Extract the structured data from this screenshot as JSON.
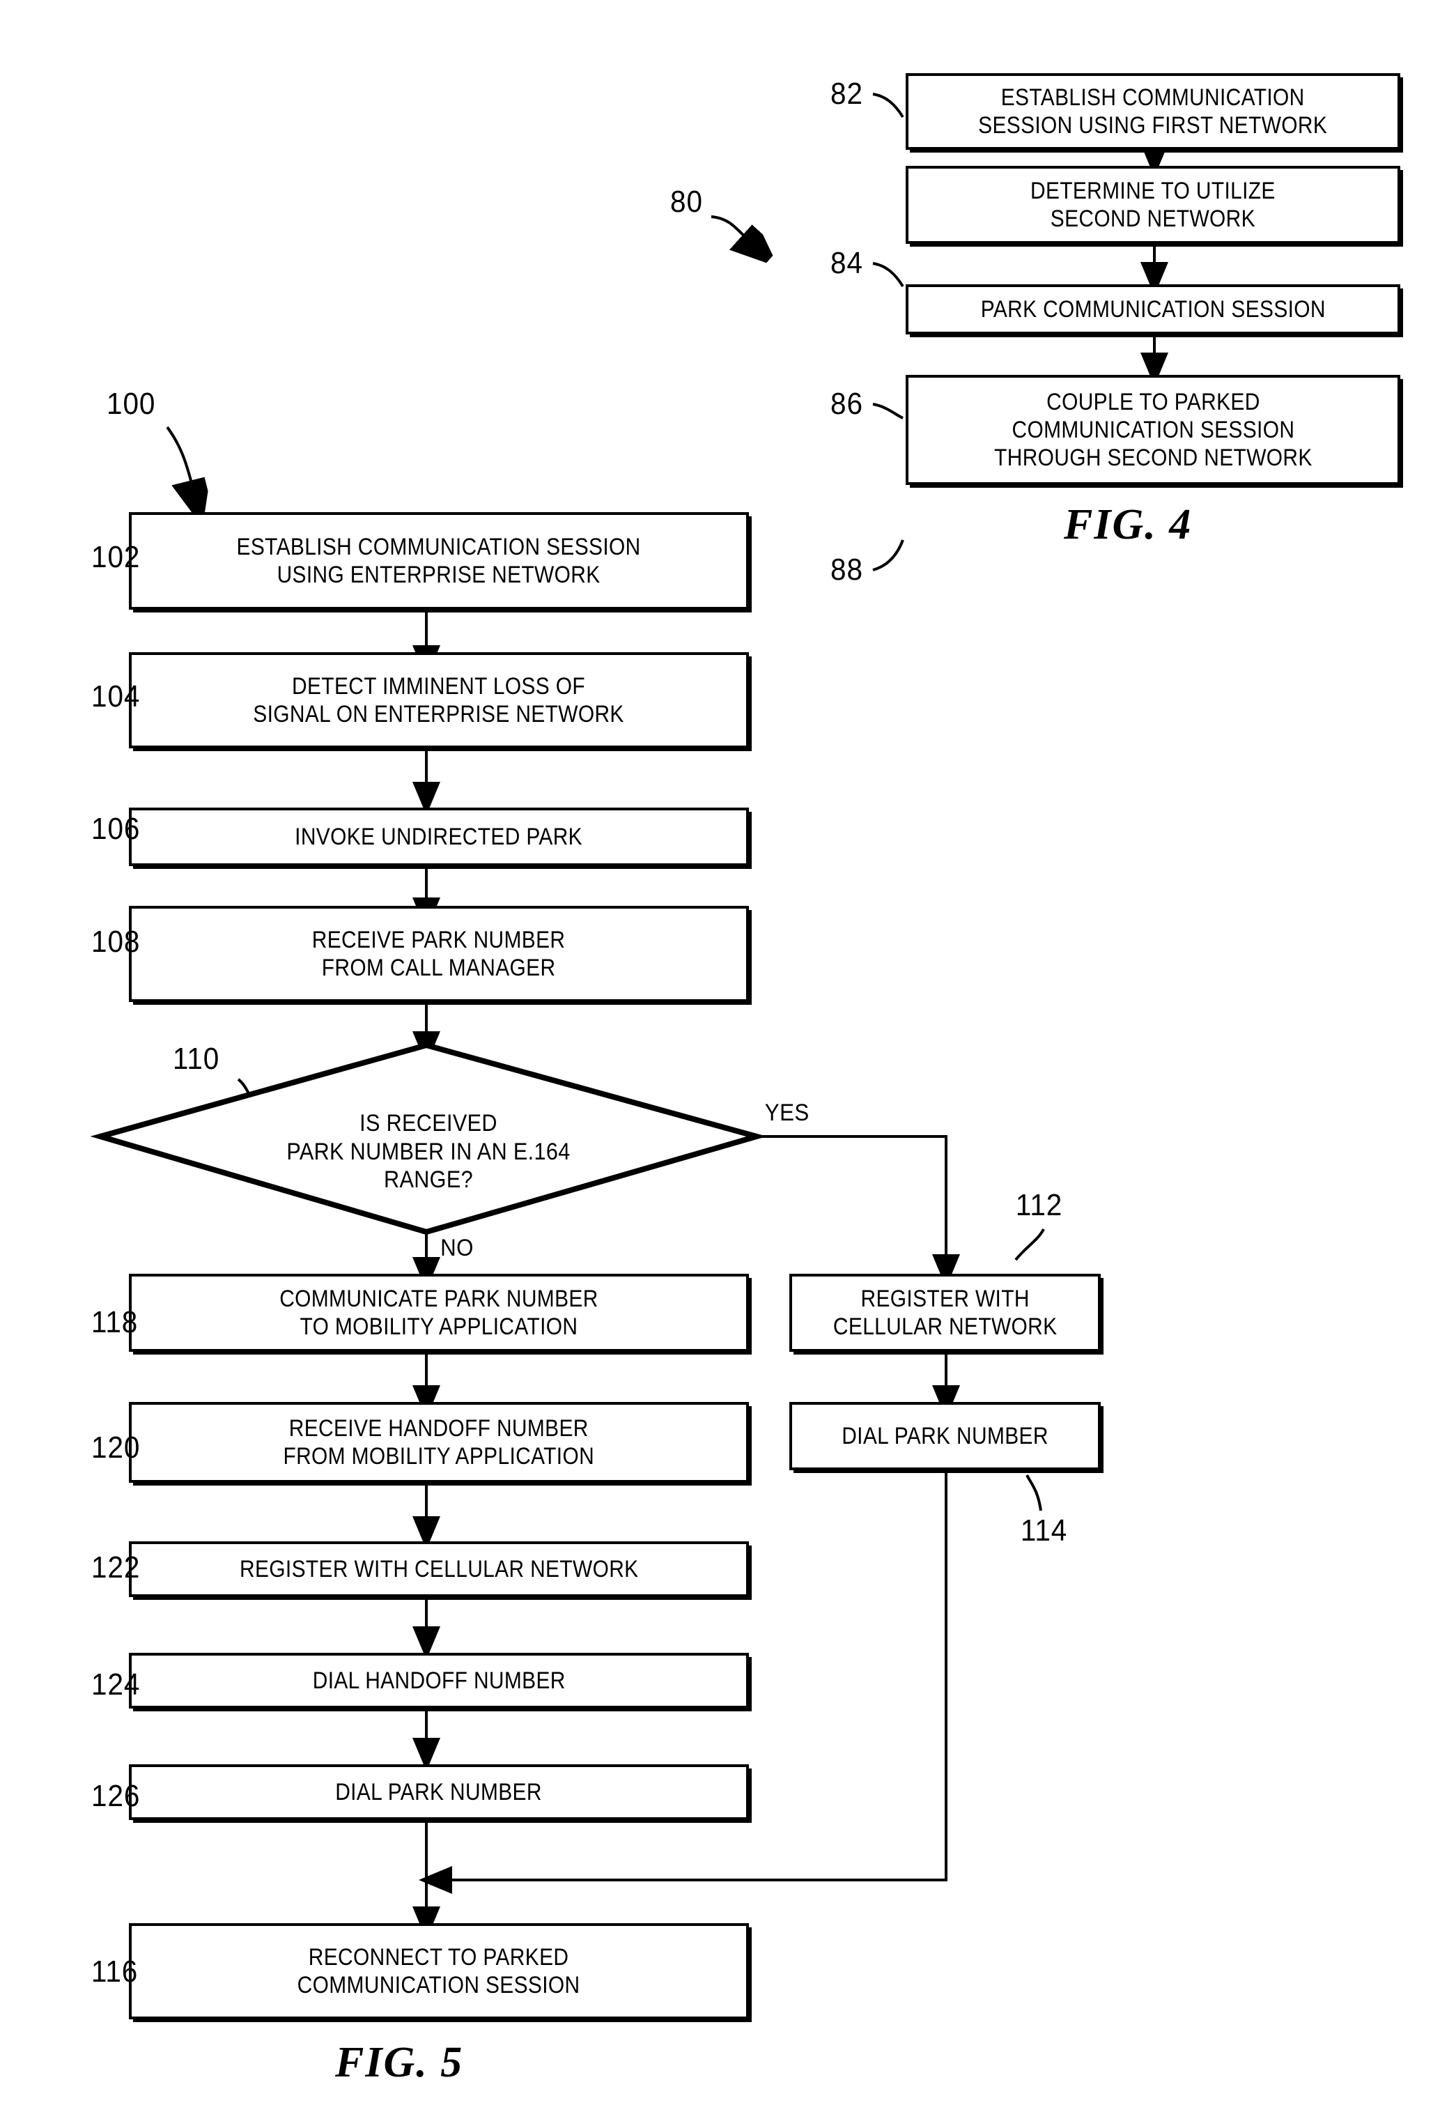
{
  "document": {
    "kind": "patent-figure-sheet",
    "figures": [
      "FIG. 4",
      "FIG. 5"
    ]
  },
  "fig4": {
    "caption": "FIG. 4",
    "flow_ref": "80",
    "type": "flowchart",
    "steps": [
      {
        "ref": "82",
        "text": "ESTABLISH COMMUNICATION\nSESSION USING FIRST NETWORK"
      },
      {
        "ref": "84",
        "text": "DETERMINE TO UTILIZE\nSECOND NETWORK"
      },
      {
        "ref": "86",
        "text": "PARK COMMUNICATION SESSION"
      },
      {
        "ref": "88",
        "text": "COUPLE TO PARKED\nCOMMUNICATION SESSION\nTHROUGH SECOND NETWORK"
      }
    ]
  },
  "fig5": {
    "caption": "FIG. 5",
    "flow_ref": "100",
    "type": "flowchart",
    "steps": [
      {
        "ref": "102",
        "text": "ESTABLISH COMMUNICATION SESSION\nUSING ENTERPRISE NETWORK"
      },
      {
        "ref": "104",
        "text": "DETECT IMMINENT LOSS OF\nSIGNAL ON ENTERPRISE NETWORK"
      },
      {
        "ref": "106",
        "text": "INVOKE UNDIRECTED PARK"
      },
      {
        "ref": "108",
        "text": "RECEIVE PARK NUMBER\nFROM CALL MANAGER"
      }
    ],
    "decision": {
      "ref": "110",
      "text": "IS RECEIVED\nPARK NUMBER IN AN E.164\nRANGE?",
      "yes_label": "YES",
      "no_label": "NO"
    },
    "yes_branch": [
      {
        "ref": "112",
        "text": "REGISTER WITH\nCELLULAR NETWORK"
      },
      {
        "ref": "114",
        "text": "DIAL PARK NUMBER"
      }
    ],
    "no_branch": [
      {
        "ref": "118",
        "text": "COMMUNICATE PARK NUMBER\nTO MOBILITY APPLICATION"
      },
      {
        "ref": "120",
        "text": "RECEIVE HANDOFF NUMBER\nFROM MOBILITY APPLICATION"
      },
      {
        "ref": "122",
        "text": "REGISTER WITH CELLULAR NETWORK"
      },
      {
        "ref": "124",
        "text": "DIAL HANDOFF NUMBER"
      },
      {
        "ref": "126",
        "text": "DIAL PARK NUMBER"
      }
    ],
    "merge_step": {
      "ref": "116",
      "text": "RECONNECT TO PARKED\nCOMMUNICATION SESSION"
    }
  },
  "colors": {
    "ink": "#000000",
    "paper": "#ffffff"
  }
}
